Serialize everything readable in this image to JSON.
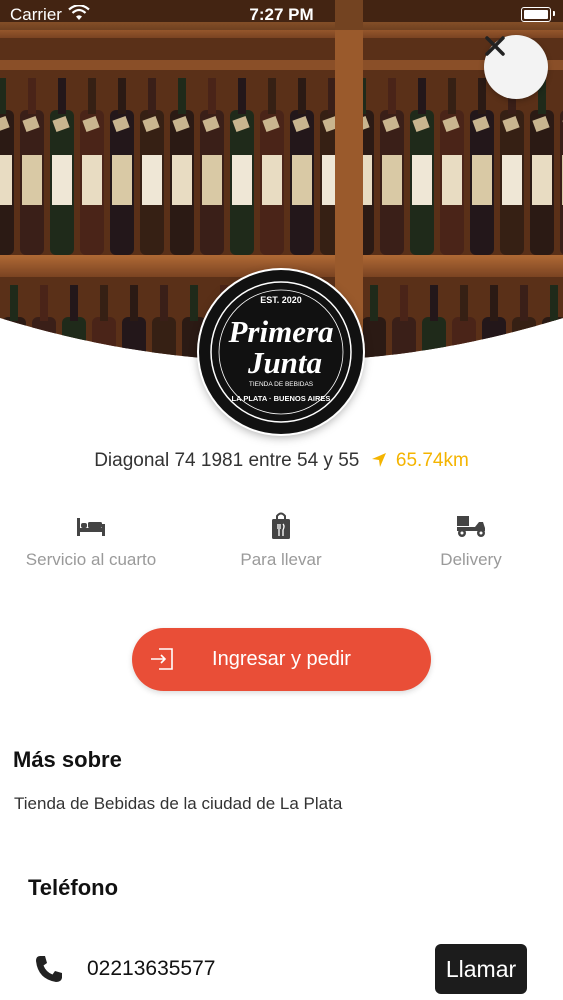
{
  "status_bar": {
    "carrier": "Carrier",
    "time": "7:27 PM"
  },
  "store": {
    "logo": {
      "est": "EST. 2020",
      "name_line1": "Primera",
      "name_line2": "Junta",
      "tagline": "TIENDA DE BEBIDAS",
      "location": "LA PLATA · BUENOS AIRES"
    },
    "address": "Diagonal 74 1981 entre 54 y 55",
    "distance": "65.74km"
  },
  "services": [
    {
      "label": "Servicio al cuarto",
      "icon": "bed-icon"
    },
    {
      "label": "Para llevar",
      "icon": "takeaway-bag-icon"
    },
    {
      "label": "Delivery",
      "icon": "delivery-scooter-icon"
    }
  ],
  "cta": {
    "label": "Ingresar y pedir",
    "icon": "login-icon"
  },
  "about": {
    "title": "Más sobre",
    "text": "Tienda de Bebidas de la ciudad de La Plata"
  },
  "phone": {
    "title": "Teléfono",
    "number": "02213635577",
    "call_label": "Llamar"
  },
  "colors": {
    "accent": "#e94e37",
    "distance": "#f4b400",
    "call_button": "#1c1c1c"
  }
}
